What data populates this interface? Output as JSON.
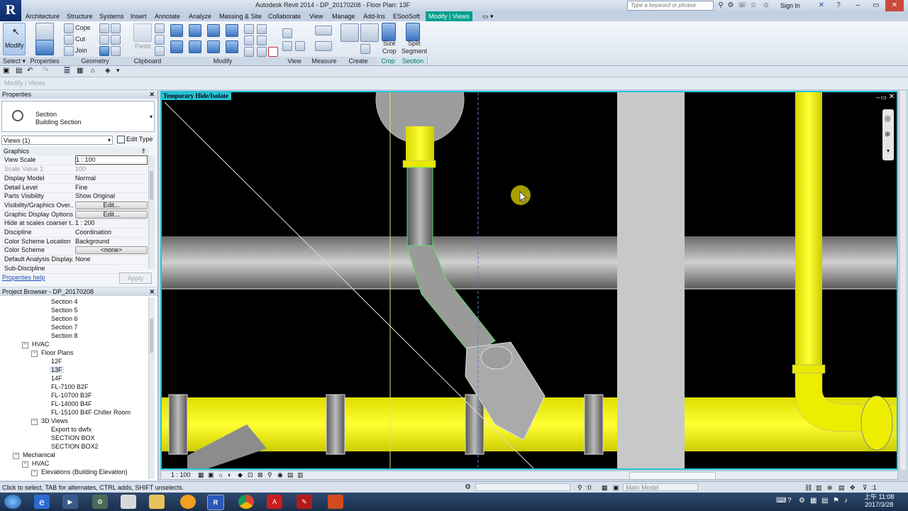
{
  "title": "Autodesk Revit 2014 -    DP_20170208 - Floor Plan: 13F",
  "app_logo": "R",
  "search": {
    "placeholder": "Type a keyword or phrase"
  },
  "signin": "Sign In",
  "menu_tabs": [
    "Architecture",
    "Structure",
    "Systems",
    "Insert",
    "Annotate",
    "Analyze",
    "Massing & Site",
    "Collaborate",
    "View",
    "Manage",
    "Add-Ins",
    "ESooSoft",
    "Modify | Views"
  ],
  "active_tab": "Modify | Views",
  "ribbon": {
    "modify": "Modify",
    "cope": "Cope",
    "cut": "Cut",
    "join": "Join",
    "paste": "Paste",
    "size_crop_1": "Size",
    "size_crop_2": "Crop",
    "split_1": "Split",
    "split_2": "Segment",
    "panels": [
      {
        "label": "Select ▾"
      },
      {
        "label": "Properties"
      },
      {
        "label": "Geometry"
      },
      {
        "label": "Clipboard"
      },
      {
        "label": "Modify"
      },
      {
        "label": "View"
      },
      {
        "label": "Measure"
      },
      {
        "label": "Create"
      },
      {
        "label": "Crop"
      },
      {
        "label": "Section"
      }
    ]
  },
  "context_bar": "Modify | Views",
  "properties": {
    "header": "Properties",
    "type_name_1": "Section",
    "type_name_2": "Building Section",
    "views_selector": "Views (1)",
    "edit_type": "Edit Type",
    "group": "Graphics",
    "rows": [
      {
        "k": "View Scale",
        "v": "1 : 100"
      },
      {
        "k": "Scale Value    1:",
        "v": "100"
      },
      {
        "k": "Display Model",
        "v": "Normal"
      },
      {
        "k": "Detail Level",
        "v": "Fine"
      },
      {
        "k": "Parts Visibility",
        "v": "Show Original"
      },
      {
        "k": "Visibility/Graphics Over...",
        "v": "Edit..."
      },
      {
        "k": "Graphic Display Options",
        "v": "Edit..."
      },
      {
        "k": "Hide at scales coarser t...",
        "v": "1 : 200"
      },
      {
        "k": "Discipline",
        "v": "Coordination"
      },
      {
        "k": "Color Scheme Location",
        "v": "Background"
      },
      {
        "k": "Color Scheme",
        "v": "<none>"
      },
      {
        "k": "Default Analysis Display...",
        "v": "None"
      },
      {
        "k": "Sub-Discipline",
        "v": ""
      }
    ],
    "help": "Properties help",
    "apply": "Apply"
  },
  "browser": {
    "header": "Project Browser - DP_20170208",
    "items": [
      {
        "t": "Section 4"
      },
      {
        "t": "Section 5"
      },
      {
        "t": "Section 6"
      },
      {
        "t": "Section 7"
      },
      {
        "t": "Section 8"
      },
      {
        "t": "HVAC"
      },
      {
        "t": "Floor Plans"
      },
      {
        "t": "12F"
      },
      {
        "t": "13F"
      },
      {
        "t": "14F"
      },
      {
        "t": "FL-7100 B2F"
      },
      {
        "t": "FL-10700 B3F"
      },
      {
        "t": "FL-14000 B4F"
      },
      {
        "t": "FL-15100 B4F Chiller Room"
      },
      {
        "t": "3D Views"
      },
      {
        "t": "Export to dwfx"
      },
      {
        "t": "SECTION BOX"
      },
      {
        "t": "SECTION BOX2"
      },
      {
        "t": "Mechanical"
      },
      {
        "t": "HVAC"
      },
      {
        "t": "Elevations (Building Elevation)"
      }
    ]
  },
  "canvas": {
    "label": "Temporary Hide/Isolate"
  },
  "viewbar": {
    "scale": "1 : 100"
  },
  "status": {
    "text": "Click to select, TAB for alternates, CTRL adds, SHIFT unselects.",
    "filter_count": ":0",
    "model": "Main Model",
    "select_count": ":1"
  },
  "clock": {
    "time": "上午 11:08",
    "date": "2017/3/28"
  },
  "colors": {
    "accent": "#00a08e",
    "pipe_yellow": "#ffff00",
    "canvas_border": "#24c3d8"
  }
}
